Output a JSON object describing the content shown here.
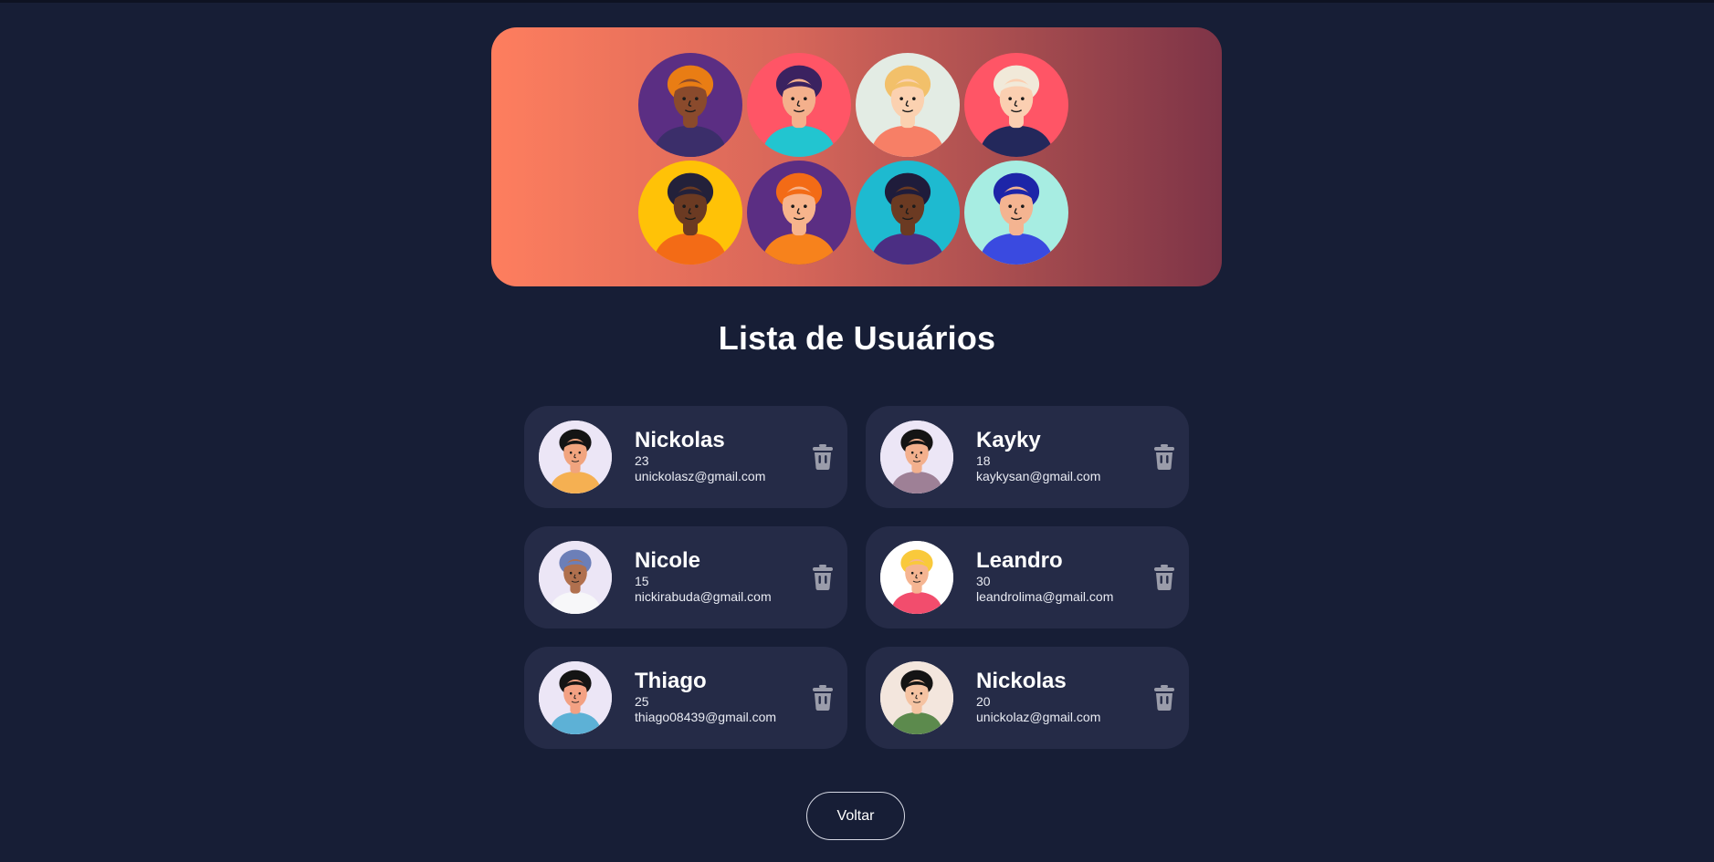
{
  "page": {
    "title": "Lista de Usuários",
    "background": "#171e36"
  },
  "banner": {
    "gradient": [
      "#fe7e5e",
      "#7e3447"
    ],
    "avatars": [
      {
        "icon": "woman-curly-orange-hair-avatar-icon",
        "bg": "#5b2e83",
        "skin": "#8a4a2c",
        "hair": "#e97d14",
        "shirt": "#3b2e6a"
      },
      {
        "icon": "woman-cyan-cap-avatar-icon",
        "bg": "#ff5566",
        "skin": "#f4b08c",
        "hair": "#3b2260",
        "shirt": "#22c5d0"
      },
      {
        "icon": "woman-blonde-ponytail-avatar-icon",
        "bg": "#e3ece4",
        "skin": "#fbd1b0",
        "hair": "#f2c06a",
        "shirt": "#f77f66"
      },
      {
        "icon": "man-white-hair-avatar-icon",
        "bg": "#ff5566",
        "skin": "#fbcfb1",
        "hair": "#f1e9d9",
        "shirt": "#23285b"
      },
      {
        "icon": "man-glasses-avatar-icon",
        "bg": "#ffc207",
        "skin": "#6b3a22",
        "hair": "#23213a",
        "shirt": "#f36b16"
      },
      {
        "icon": "man-ginger-avatar-icon",
        "bg": "#5b2e83",
        "skin": "#f7b48c",
        "hair": "#f36b16",
        "shirt": "#f7821c"
      },
      {
        "icon": "man-purple-hoodie-avatar-icon",
        "bg": "#1ebad0",
        "skin": "#6b3a22",
        "hair": "#1f1c3b",
        "shirt": "#4b2e83"
      },
      {
        "icon": "man-curly-beard-avatar-icon",
        "bg": "#a7ede2",
        "skin": "#f4b491",
        "hair": "#1d25a8",
        "shirt": "#3a4ae0"
      }
    ]
  },
  "users": [
    {
      "name": "Nickolas",
      "age": "23",
      "email": "unickolasz@gmail.com",
      "icon": "woman-black-hair-avatar-icon",
      "bg": "#ece6f6",
      "skin": "#f1a47e",
      "hair": "#141414",
      "shirt": "#f5b052"
    },
    {
      "name": "Kayky",
      "age": "18",
      "email": "kaykysan@gmail.com",
      "icon": "man-beard-avatar-icon",
      "bg": "#ece6f6",
      "skin": "#f3b08d",
      "hair": "#141414",
      "shirt": "#9e8096"
    },
    {
      "name": "Nicole",
      "age": "15",
      "email": "nickirabuda@gmail.com",
      "icon": "woman-hijab-avatar-icon",
      "bg": "#ece6f6",
      "skin": "#b0704e",
      "hair": "#6c7fb8",
      "shirt": "#f7f7f9"
    },
    {
      "name": "Leandro",
      "age": "30",
      "email": "leandrolima@gmail.com",
      "icon": "woman-blonde-avatar-icon",
      "bg": "#ffffff",
      "skin": "#f5b592",
      "hair": "#f9c93b",
      "shirt": "#f24d6d"
    },
    {
      "name": "Thiago",
      "age": "25",
      "email": "thiago08439@gmail.com",
      "icon": "woman-bun-hair-avatar-icon",
      "bg": "#ece6f6",
      "skin": "#f3a183",
      "hair": "#141414",
      "shirt": "#5db1d6"
    },
    {
      "name": "Nickolas",
      "age": "20",
      "email": "unickolaz@gmail.com",
      "icon": "man-green-jacket-avatar-icon",
      "bg": "#f3e6dd",
      "skin": "#f5c3a2",
      "hair": "#141414",
      "shirt": "#5c8a4d"
    }
  ],
  "actions": {
    "back_label": "Voltar",
    "delete_icon": "trash-icon"
  },
  "colors": {
    "card": "#252b47",
    "trash": "#9a9caa",
    "text": "#ffffff"
  }
}
